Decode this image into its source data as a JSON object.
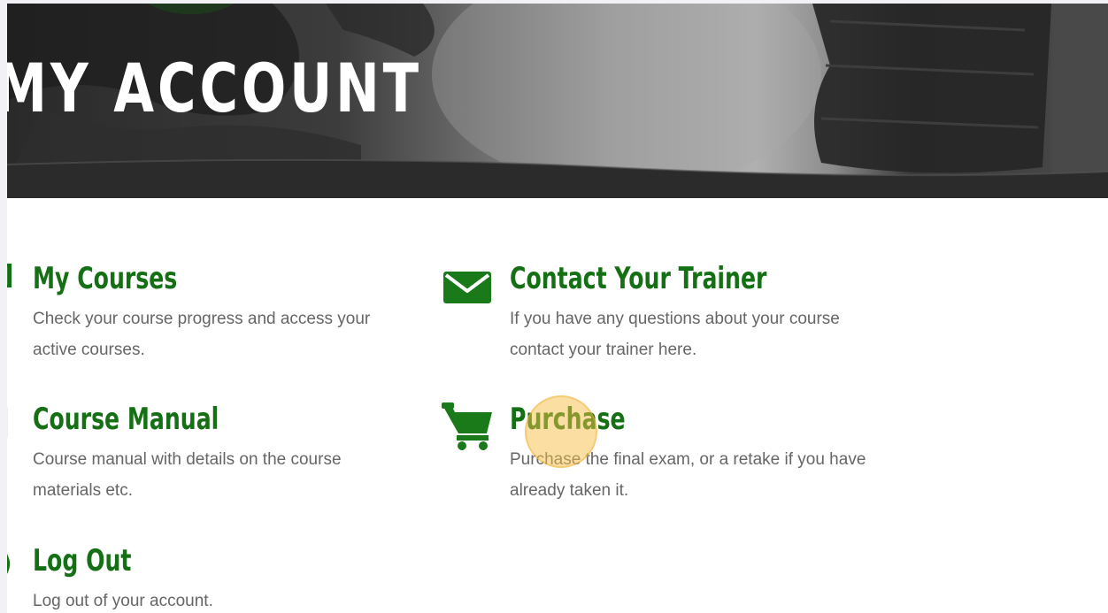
{
  "hero": {
    "title": "MY ACCOUNT"
  },
  "cards": [
    {
      "id": "my-courses",
      "title": "My Courses",
      "description": "Check your course progress and access your active courses.",
      "icon": "book-icon"
    },
    {
      "id": "contact-trainer",
      "title": "Contact Your Trainer",
      "description": "If you have any questions about your course contact your trainer here.",
      "icon": "envelope-icon"
    },
    {
      "id": "course-manual",
      "title": "Course Manual",
      "description": "Course manual with details on the course materials etc.",
      "icon": "document-icon"
    },
    {
      "id": "purchase",
      "title": "Purchase",
      "description": "Purchase the final exam, or a retake if you have already taken it.",
      "icon": "cart-icon"
    },
    {
      "id": "log-out",
      "title": "Log Out",
      "description": "Log out of your account.",
      "icon": "power-icon"
    }
  ],
  "colors": {
    "accent_green": "#157015",
    "text_gray": "#666666",
    "hero_dark": "#2a2a2a",
    "click_marker": "#f5be46"
  }
}
